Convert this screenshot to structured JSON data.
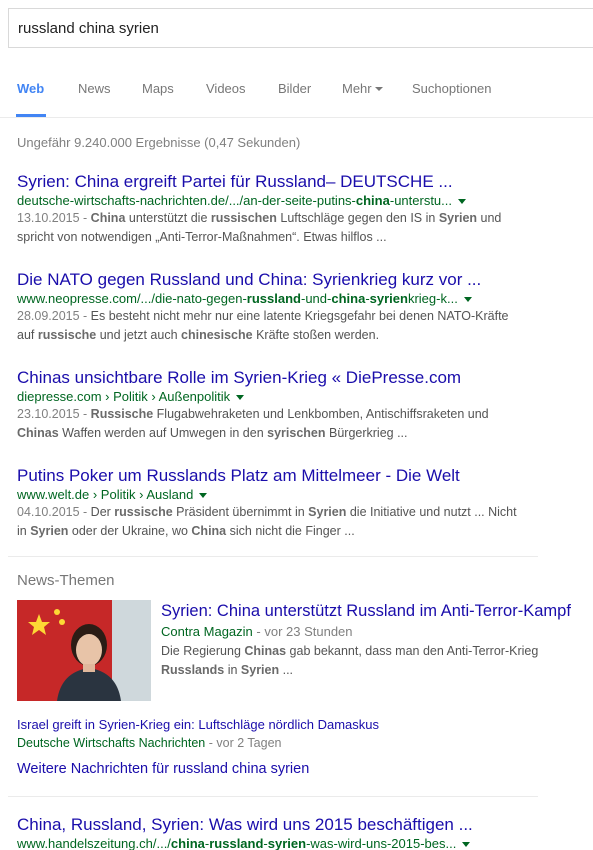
{
  "search": {
    "query": "russland china syrien"
  },
  "tabs": [
    {
      "label": "Web",
      "active": true
    },
    {
      "label": "News"
    },
    {
      "label": "Maps"
    },
    {
      "label": "Videos"
    },
    {
      "label": "Bilder"
    },
    {
      "label": "Mehr"
    },
    {
      "label": "Suchoptionen"
    }
  ],
  "stats": "Ungefähr 9.240.000 Ergebnisse (0,47 Sekunden)",
  "results": [
    {
      "title": "Syrien: China ergreift Partei für Russland– DEUTSCHE ...",
      "url_html": "deutsche-wirtschafts-nachrichten.de/.../an-der-seite-putins-<b>china</b>-unterstu...",
      "date": "13.10.2015 - ",
      "snippet_html": "<b>China</b> unterstützt die <b>russischen</b> Luftschläge gegen den IS in <b>Syrien</b> und spricht von notwendigen „Anti-Terror-Maßnahmen“. Etwas hilflos ..."
    },
    {
      "title": "Die NATO gegen Russland und China: Syrienkrieg kurz vor ...",
      "url_html": "www.neopresse.com/.../die-nato-gegen-<b>russland</b>-und-<b>china</b>-<b>syrien</b>krieg-k...",
      "date": "28.09.2015 - ",
      "snippet_html": "Es besteht nicht mehr nur eine latente Kriegsgefahr bei denen NATO-Kräfte auf <b>russische</b> und jetzt auch <b>chinesische</b> Kräfte stoßen werden."
    },
    {
      "title": "Chinas unsichtbare Rolle im Syrien-Krieg « DiePresse.com",
      "url_html": "diepresse.com › Politik › Außenpolitik",
      "date": "23.10.2015 - ",
      "snippet_html": "<b>Russische</b> Flugabwehraketen und Lenkbomben, Antischiffsraketen und <b>Chinas</b> Waffen werden auf Umwegen in den <b>syrischen</b> Bürgerkrieg ..."
    },
    {
      "title": "Putins Poker um Russlands Platz am Mittelmeer - Die Welt",
      "url_html": "www.welt.de › Politik › Ausland",
      "date": "04.10.2015 - ",
      "snippet_html": "Der <b>russische</b> Präsident übernimmt in <b>Syrien</b> die Initiative und nutzt ... Nicht in <b>Syrien</b> oder der Ukraine, wo <b>China</b> sich nicht die Finger ..."
    }
  ],
  "news": {
    "heading": "News-Themen",
    "main": {
      "title": "Syrien: China unterstützt Russland im Anti-Terror-Kampf",
      "source": "Contra Magazin",
      "time": " - vor 23 Stunden",
      "snippet_html": "Die Regierung <b>Chinas</b> gab bekannt, dass man den Anti-Terror-Krieg <b>Russlands</b> in <b>Syrien</b> ..."
    },
    "secondary": {
      "title": "Israel greift in Syrien-Krieg ein: Luftschläge nördlich Damaskus",
      "source": "Deutsche Wirtschafts Nachrichten",
      "time": " - vor 2 Tagen"
    },
    "more": "Weitere Nachrichten für russland china syrien"
  },
  "last_result": {
    "title": "China, Russland, Syrien: Was wird uns 2015 beschäftigen ...",
    "url_html": "www.handelszeitung.ch/.../<b>china</b>-<b>russland</b>-<b>syrien</b>-was-wird-uns-2015-bes..."
  }
}
